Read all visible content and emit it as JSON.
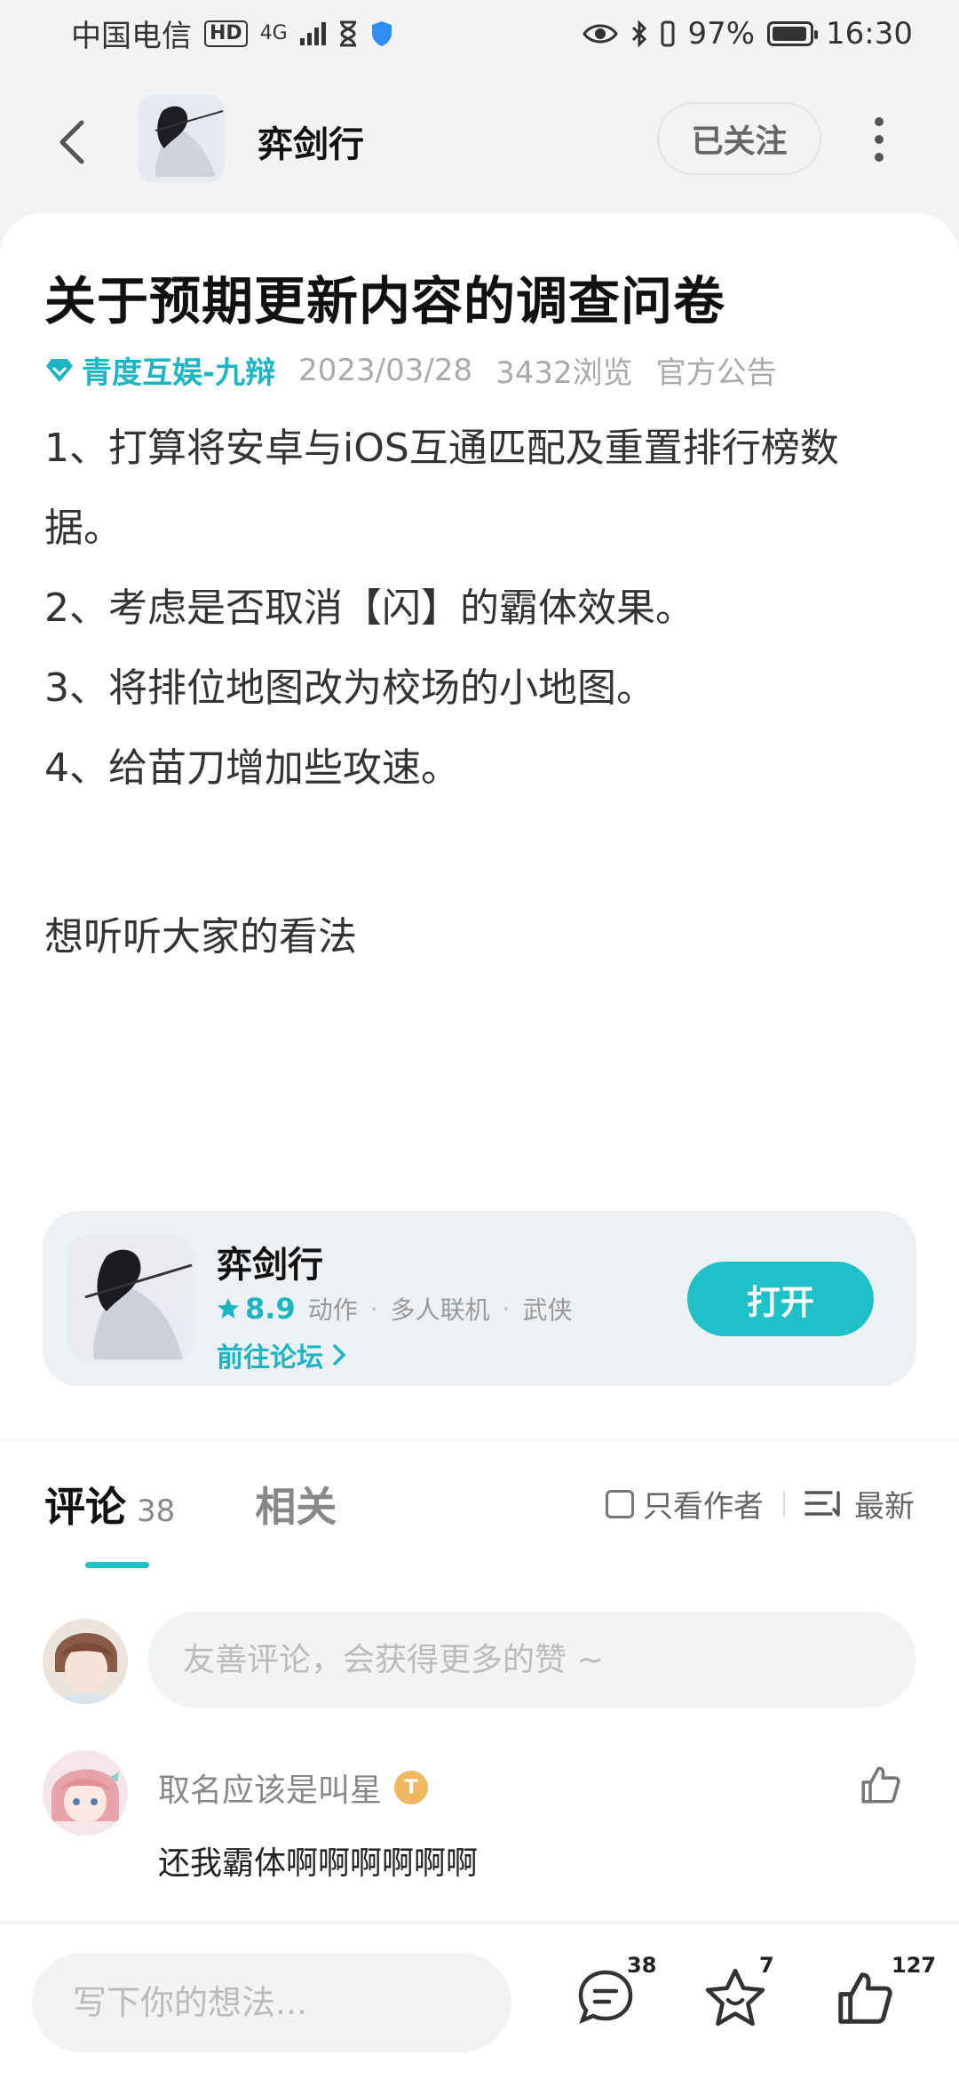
{
  "status_bar": {
    "carrier": "中国电信",
    "hd_badge": "HD",
    "network": "4G",
    "battery_percent": "97%",
    "time": "16:30"
  },
  "nav": {
    "title": "弈剑行",
    "follow_label": "已关注"
  },
  "post": {
    "title": "关于预期更新内容的调查问卷",
    "author": "青度互娱-九辩",
    "date": "2023/03/28",
    "views": "3432浏览",
    "tag": "官方公告",
    "lines": [
      "1、打算将安卓与iOS互通匹配及重置排行榜数",
      "据。",
      "2、考虑是否取消【闪】的霸体效果。",
      "3、将排位地图改为校场的小地图。",
      "4、给苗刀增加些攻速。"
    ],
    "closing": "想听听大家的看法"
  },
  "actions": {
    "like_count": "127",
    "favorite_count": "7"
  },
  "game_card": {
    "name": "弈剑行",
    "score": "8.9",
    "tags": [
      "动作",
      "多人联机",
      "武侠"
    ],
    "forum_link": "前往论坛",
    "open_label": "打开"
  },
  "comments_section": {
    "tab_comments": "评论",
    "comment_count": "38",
    "tab_related": "相关",
    "author_only": "只看作者",
    "sort_label": "最新",
    "input_placeholder": "友善评论，会获得更多的赞 ~",
    "items": [
      {
        "user": "取名应该是叫星",
        "level_badge": "T",
        "text": "还我霸体啊啊啊啊啊啊"
      }
    ]
  },
  "bottom_bar": {
    "placeholder": "写下你的想法...",
    "comment_count": "38",
    "favorite_count": "7",
    "like_count": "127"
  },
  "colors": {
    "accent": "#1fc1c9",
    "qq_blue": "#21a7ee",
    "background": "#f2f3f5"
  }
}
